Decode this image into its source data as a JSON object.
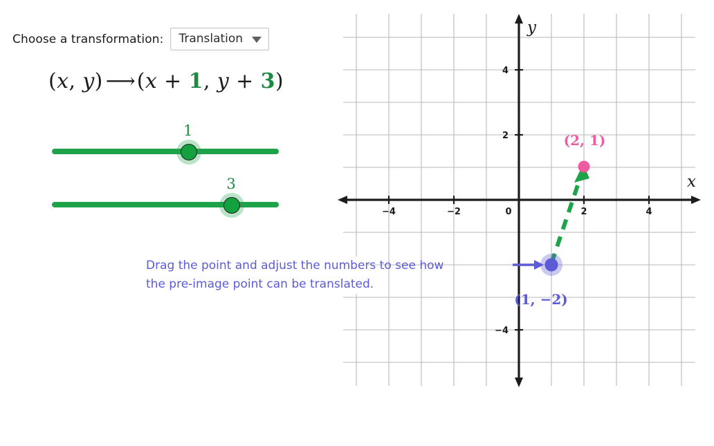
{
  "controls": {
    "chooser_label": "Choose a transformation:",
    "selected_transformation": "Translation",
    "caret_icon": "chevron-down-icon"
  },
  "formula": {
    "open": "(",
    "x": "x",
    "comma": ", ",
    "y": "y",
    "close": ")",
    "maps_to": "⟶",
    "plus": " + ",
    "dx_display": "1",
    "dy_display": "3",
    "full_text": "(x, y) ⟶ (x + 1, y + 3)"
  },
  "sliders": [
    {
      "name": "x-translation",
      "value": "1",
      "value_label": "1",
      "knob_percent": 60
    },
    {
      "name": "y-translation",
      "value": "3",
      "value_label": "3",
      "knob_percent": 79
    }
  ],
  "instructions": {
    "line1": "Drag the point and adjust the numbers to see how",
    "line2": "the pre-image point can be translated."
  },
  "colors": {
    "green": "#1fa34a",
    "green_text": "#1d8a42",
    "purple": "#5b5bd6",
    "pink": "#ef5ba1",
    "grid": "#b9b9b9",
    "axis": "#1c1c1c"
  },
  "chart_data": {
    "type": "scatter",
    "title": "",
    "xlabel": "x",
    "ylabel": "y",
    "xlim": [
      -5.1,
      5.6
    ],
    "ylim": [
      -5.6,
      5.6
    ],
    "grid": true,
    "grid_step": 1,
    "x_ticks": [
      -4,
      -2,
      0,
      2,
      4
    ],
    "x_tick_labels": [
      "−4",
      "−2",
      "0",
      "2",
      "4"
    ],
    "y_ticks": [
      4,
      2,
      -4
    ],
    "y_tick_labels": [
      "4",
      "2",
      "−4"
    ],
    "points": [
      {
        "name": "pre-image",
        "x": 1,
        "y": -2,
        "label": "(1, −2)",
        "color": "#5b5bd6",
        "draggable": true
      },
      {
        "name": "image",
        "x": 2,
        "y": 1,
        "label": "(2, 1)",
        "color": "#ef5ba1",
        "draggable": false
      }
    ],
    "vector": {
      "name": "translation-vector",
      "from": [
        1,
        -2
      ],
      "to": [
        2,
        1
      ],
      "style": "dashed",
      "color": "#1fa34a"
    },
    "pointer_arrow": {
      "name": "instruction-pointer",
      "points_to": [
        1,
        -2
      ],
      "color": "#5b5bd6"
    }
  }
}
